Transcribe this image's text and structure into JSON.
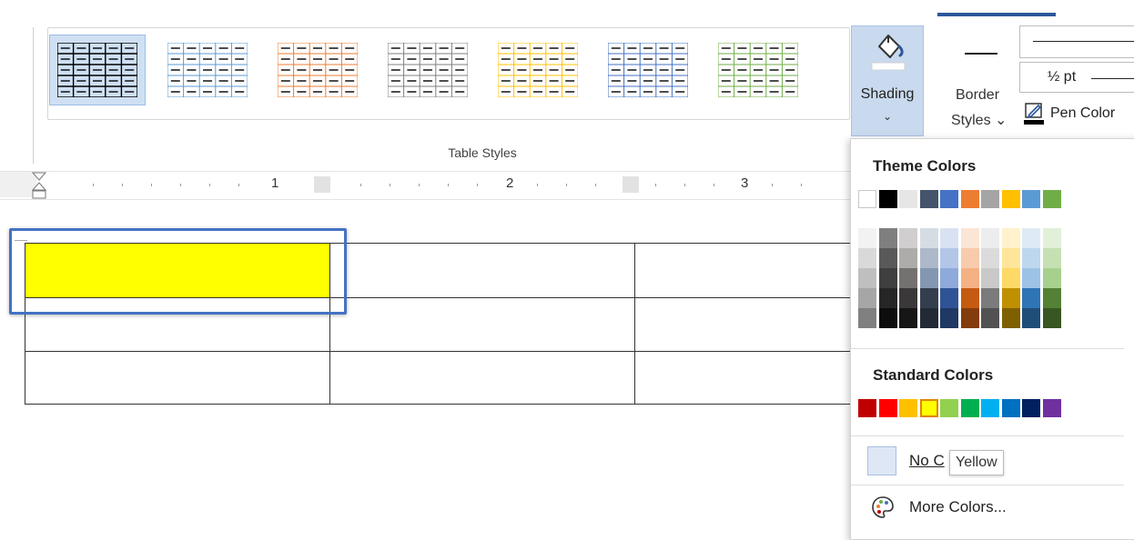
{
  "ribbon": {
    "group_label": "Table Styles",
    "shading_label": "Shading",
    "shading_caret": "⌄",
    "border_label_line1": "Border",
    "border_label_line2": "Styles ⌄",
    "weight_value": "½ pt",
    "pen_color_label": "Pen Color",
    "gallery_scroll": [
      "⌃",
      "⌄",
      "⊽"
    ],
    "table_style_colors": [
      "#000000",
      "#5b9bd5",
      "#ed7d31",
      "#7f7f7f",
      "#ffc000",
      "#4472c4",
      "#70ad47"
    ]
  },
  "ruler": {
    "numbers": [
      "1",
      "2",
      "3"
    ]
  },
  "document": {
    "highlighted_cell_color": "#ffff00"
  },
  "dropdown": {
    "theme_title": "Theme Colors",
    "standard_title": "Standard Colors",
    "no_color_label": "No C",
    "tooltip": "Yellow",
    "more_colors_label": "More Colors...",
    "theme_top_row": [
      "#ffffff",
      "#000000",
      "#e7e6e6",
      "#44546a",
      "#4472c4",
      "#ed7d31",
      "#a5a5a5",
      "#ffc000",
      "#5b9bd5",
      "#70ad47"
    ],
    "theme_shades": [
      [
        "#f2f2f2",
        "#d9d9d9",
        "#bfbfbf",
        "#a6a6a6",
        "#808080"
      ],
      [
        "#7f7f7f",
        "#595959",
        "#3f3f3f",
        "#262626",
        "#0d0d0d"
      ],
      [
        "#d0cece",
        "#aeabab",
        "#767171",
        "#3a3838",
        "#171616"
      ],
      [
        "#d6dce4",
        "#adb9ca",
        "#8497b0",
        "#333f4f",
        "#222a35"
      ],
      [
        "#d9e2f3",
        "#b4c6e7",
        "#8eaadb",
        "#2f5496",
        "#1f3864"
      ],
      [
        "#fbe5d5",
        "#f7cbac",
        "#f4b183",
        "#c55a11",
        "#833c0b"
      ],
      [
        "#ededed",
        "#dbdbdb",
        "#c9c9c9",
        "#7b7b7b",
        "#525252"
      ],
      [
        "#fff2cc",
        "#fee599",
        "#ffd966",
        "#bf9000",
        "#7f6000"
      ],
      [
        "#deebf6",
        "#bdd7ee",
        "#9cc3e5",
        "#2e75b5",
        "#1f4e79"
      ],
      [
        "#e2efd9",
        "#c5e0b3",
        "#a8d08d",
        "#538135",
        "#375623"
      ]
    ],
    "standard_colors": [
      "#c00000",
      "#ff0000",
      "#ffc000",
      "#ffff00",
      "#92d050",
      "#00b050",
      "#00b0f0",
      "#0070c0",
      "#002060",
      "#7030a0"
    ],
    "selected_standard": "Yellow"
  }
}
